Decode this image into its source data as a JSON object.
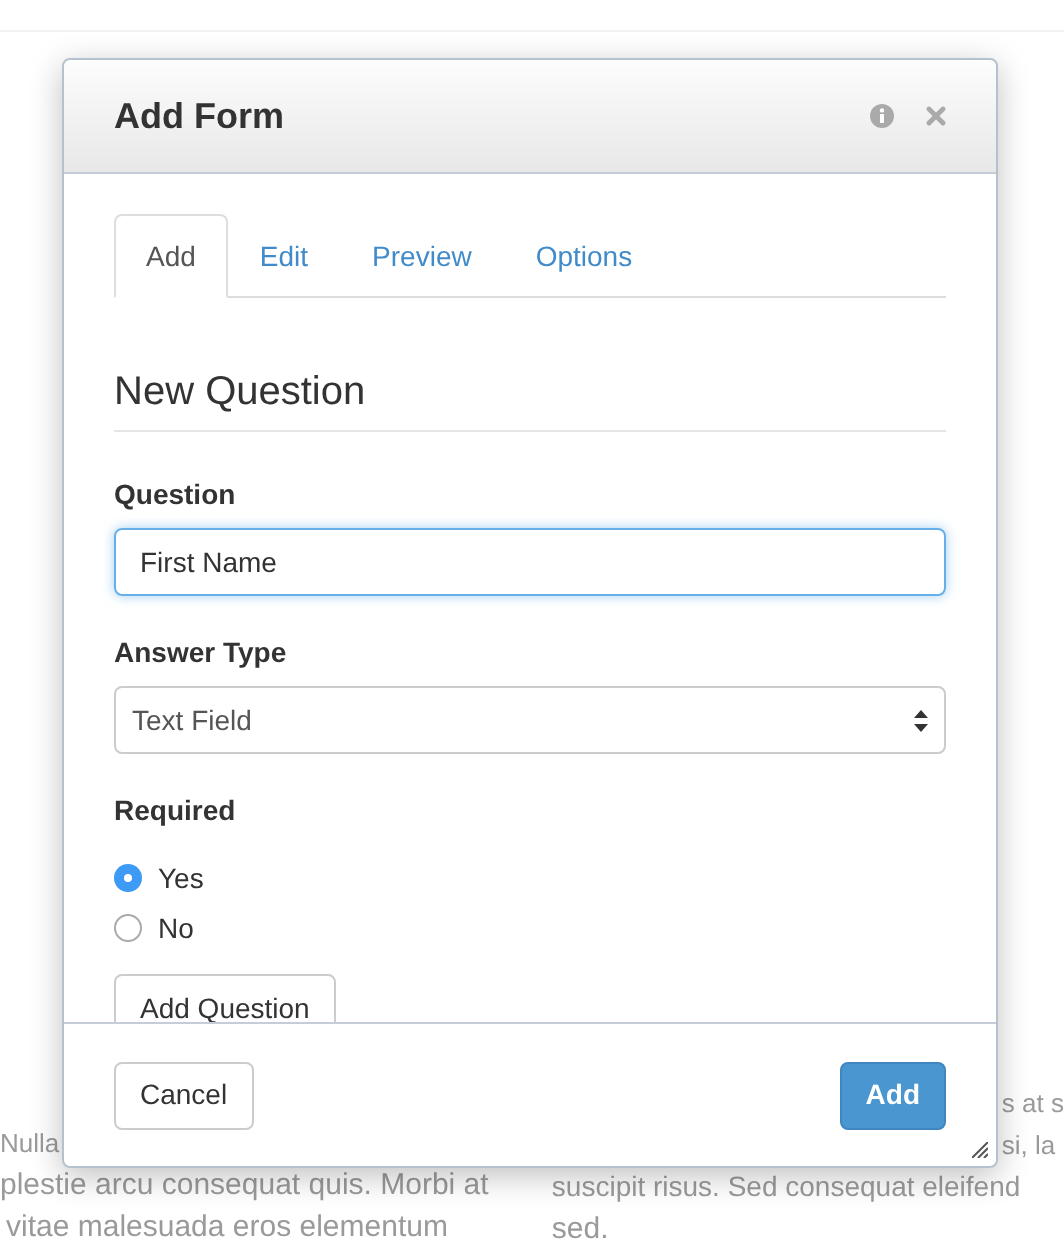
{
  "background": {
    "left_lines": [
      "Nulla",
      "plestie arcu consequat quis. Morbi at",
      "vitae malesuada eros elementum"
    ],
    "right_lines": [
      "s at s",
      "si, la",
      "suscipit risus. Sed consequat eleifend",
      "sed."
    ]
  },
  "dialog": {
    "title": "Add Form",
    "tabs": [
      {
        "label": "Add",
        "selected": true
      },
      {
        "label": "Edit",
        "selected": false
      },
      {
        "label": "Preview",
        "selected": false
      },
      {
        "label": "Options",
        "selected": false
      }
    ],
    "heading": "New Question",
    "question": {
      "label": "Question",
      "value": "First Name"
    },
    "answer_type": {
      "label": "Answer Type",
      "value": "Text Field"
    },
    "required": {
      "label": "Required",
      "options": [
        {
          "label": "Yes",
          "selected": true
        },
        {
          "label": "No",
          "selected": false
        }
      ]
    },
    "add_question_button": "Add Question",
    "cancel_button": "Cancel",
    "add_button": "Add"
  }
}
